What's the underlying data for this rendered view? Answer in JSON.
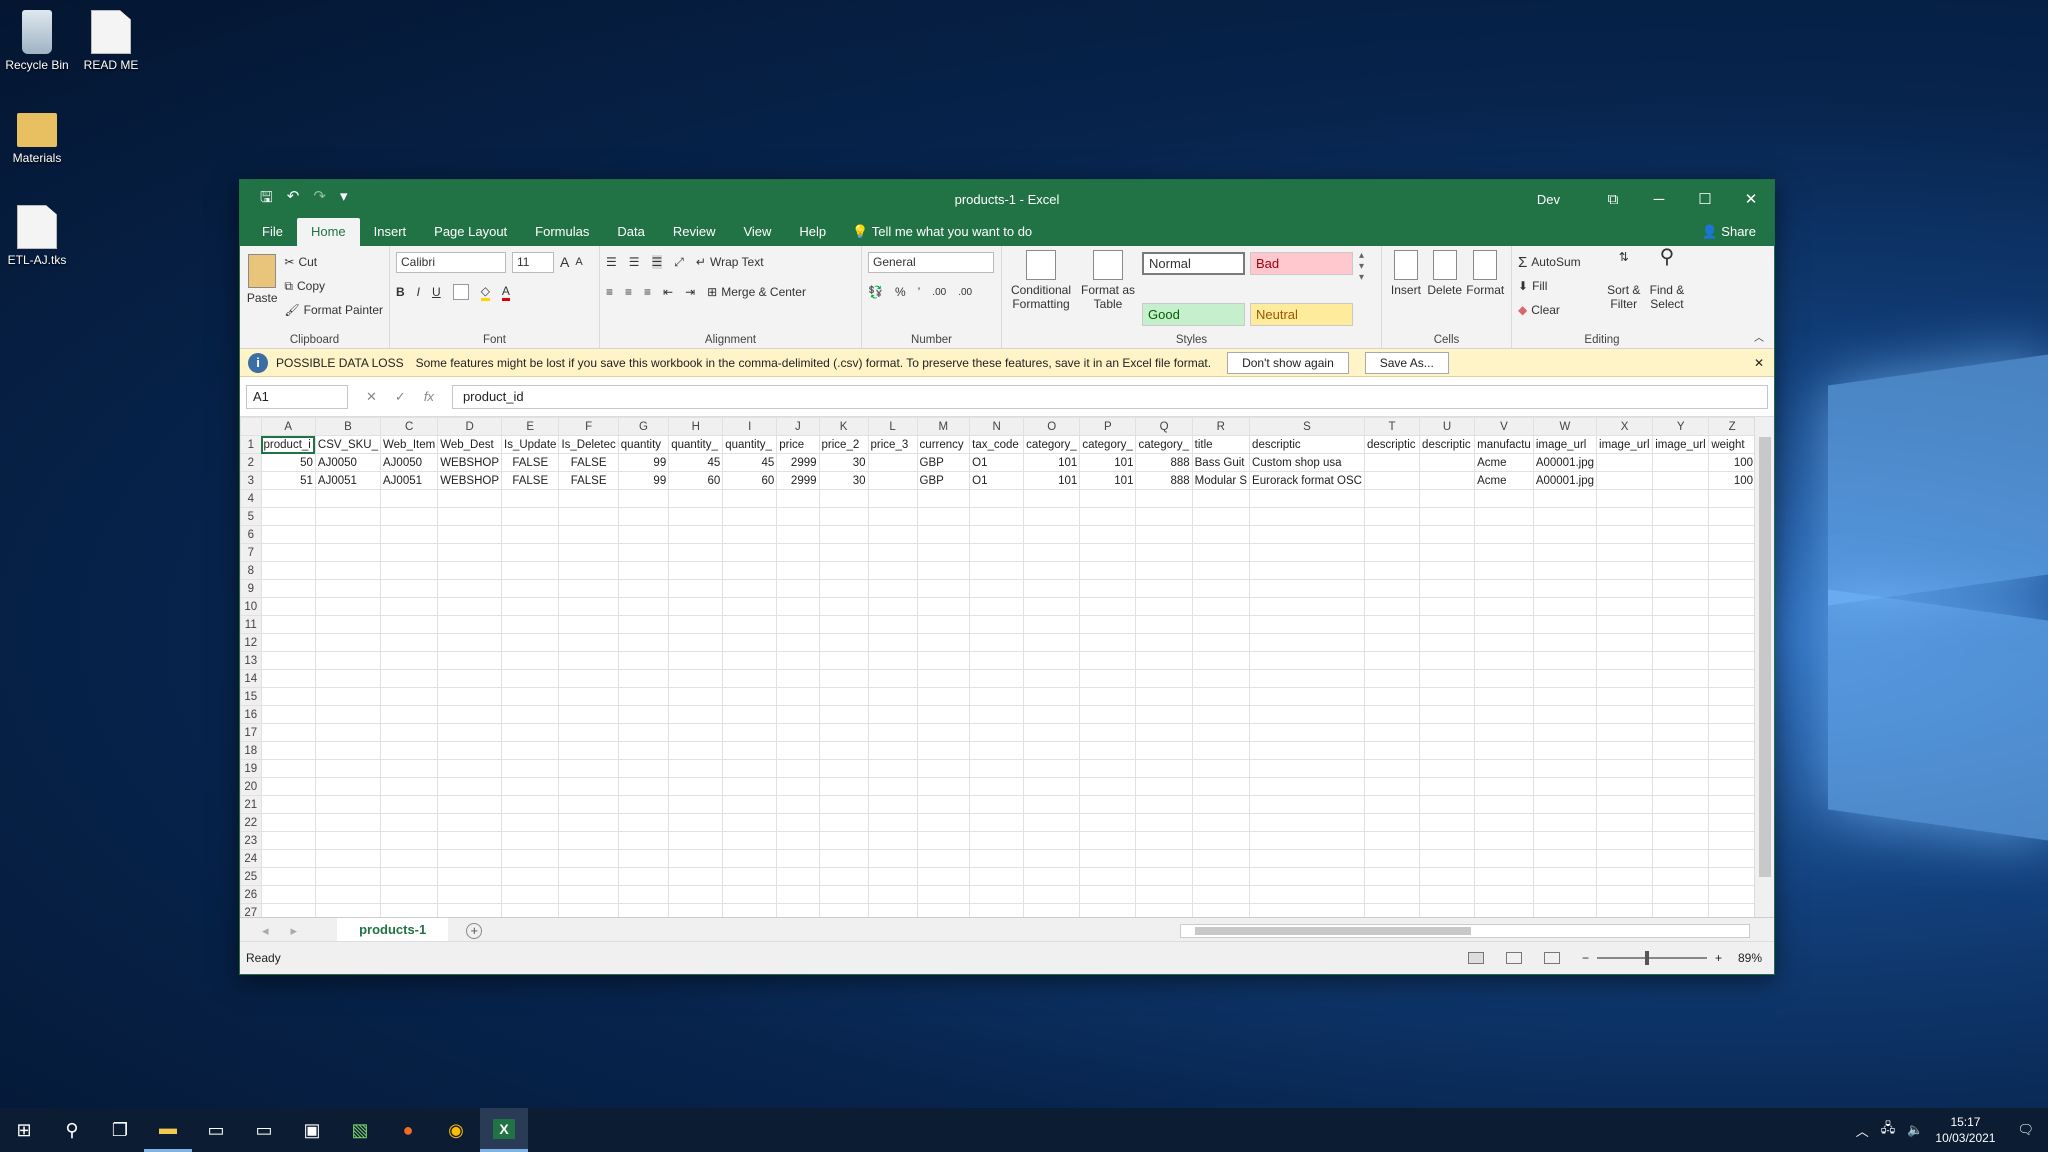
{
  "desktop": {
    "icons": [
      {
        "label": "Recycle Bin"
      },
      {
        "label": "READ ME"
      },
      {
        "label": "Materials"
      },
      {
        "label": "ETL-AJ.tks"
      }
    ]
  },
  "window": {
    "title": "products-1  -  Excel",
    "user": "Dev",
    "minimize": "─",
    "maximize": "☐",
    "close": "✕"
  },
  "qat": {
    "save": "🖫",
    "undo": "↶",
    "redo": "↷",
    "more": "▾"
  },
  "tabs": [
    "File",
    "Home",
    "Insert",
    "Page Layout",
    "Formulas",
    "Data",
    "Review",
    "View",
    "Help"
  ],
  "tellme": "Tell me what you want to do",
  "share": "Share",
  "ribbon": {
    "clipboard": {
      "paste": "Paste",
      "cut": "Cut",
      "copy": "Copy",
      "format_painter": "Format Painter",
      "group": "Clipboard"
    },
    "font": {
      "name": "Calibri",
      "size": "11",
      "bold": "B",
      "italic": "I",
      "underline": "U",
      "group": "Font",
      "grow": "A",
      "shrink": "A",
      "fontcolor": "A"
    },
    "alignment": {
      "wrap": "Wrap Text",
      "merge": "Merge & Center",
      "group": "Alignment"
    },
    "number": {
      "format": "General",
      "percent": "%",
      "comma": "’",
      "inc": ".00",
      "dec": ".00",
      "group": "Number"
    },
    "styles": {
      "conditional": "Conditional Formatting",
      "format_table": "Format as Table",
      "normal": "Normal",
      "bad": "Bad",
      "good": "Good",
      "neutral": "Neutral",
      "group": "Styles"
    },
    "cells": {
      "insert": "Insert",
      "delete": "Delete",
      "format": "Format",
      "group": "Cells"
    },
    "editing": {
      "autosum": "AutoSum",
      "fill": "Fill",
      "clear": "Clear",
      "sort": "Sort & Filter",
      "find": "Find & Select",
      "group": "Editing"
    }
  },
  "infobar": {
    "title": "POSSIBLE DATA LOSS",
    "message": "Some features might be lost if you save this workbook in the comma-delimited (.csv) format. To preserve these features, save it in an Excel file format.",
    "dont_show": "Don't show again",
    "save_as": "Save As..."
  },
  "formula_bar": {
    "cell": "A1",
    "value": "product_id",
    "fx": "fx"
  },
  "columns": [
    "A",
    "B",
    "C",
    "D",
    "E",
    "F",
    "G",
    "H",
    "I",
    "J",
    "K",
    "L",
    "M",
    "N",
    "O",
    "P",
    "Q",
    "R",
    "S",
    "T",
    "U",
    "V",
    "W",
    "X",
    "Y",
    "Z"
  ],
  "rows": [
    [
      "product_i",
      "CSV_SKU_",
      "Web_Item",
      "Web_Dest",
      "Is_Update",
      "Is_Deletec",
      "quantity",
      "quantity_",
      "quantity_",
      "price",
      "price_2",
      "price_3",
      "currency",
      "tax_code",
      "category_",
      "category_",
      "category_",
      "title",
      "descriptic",
      "descriptic",
      "descriptic",
      "manufactu",
      "image_url",
      "image_url",
      "image_url",
      "weight"
    ],
    [
      "50",
      "AJ0050",
      "AJ0050",
      "WEBSHOP",
      "FALSE",
      "FALSE",
      "99",
      "45",
      "45",
      "2999",
      "30",
      "",
      "GBP",
      "O1",
      "101",
      "101",
      "888",
      "Bass Guit",
      "Custom shop usa",
      "",
      "",
      "Acme",
      "A00001.jpg",
      "",
      "",
      "100"
    ],
    [
      "51",
      "AJ0051",
      "AJ0051",
      "WEBSHOP",
      "FALSE",
      "FALSE",
      "99",
      "60",
      "60",
      "2999",
      "30",
      "",
      "GBP",
      "O1",
      "101",
      "101",
      "888",
      "Modular S",
      "Eurorack format OSC",
      "",
      "",
      "Acme",
      "A00001.jpg",
      "",
      "",
      "100"
    ]
  ],
  "row_numbers": [
    "1",
    "2",
    "3",
    "4",
    "5",
    "6",
    "7",
    "8",
    "9",
    "10",
    "11",
    "12",
    "13",
    "14",
    "15",
    "16",
    "17",
    "18",
    "19",
    "20",
    "21",
    "22",
    "23",
    "24",
    "25",
    "26",
    "27"
  ],
  "sheet": {
    "name": "products-1",
    "add": "+"
  },
  "status": {
    "text": "Ready",
    "zoom": "89%",
    "zoom_out": "−",
    "zoom_in": "+"
  },
  "taskbar": {
    "time": "15:17",
    "date": "10/03/2021"
  }
}
